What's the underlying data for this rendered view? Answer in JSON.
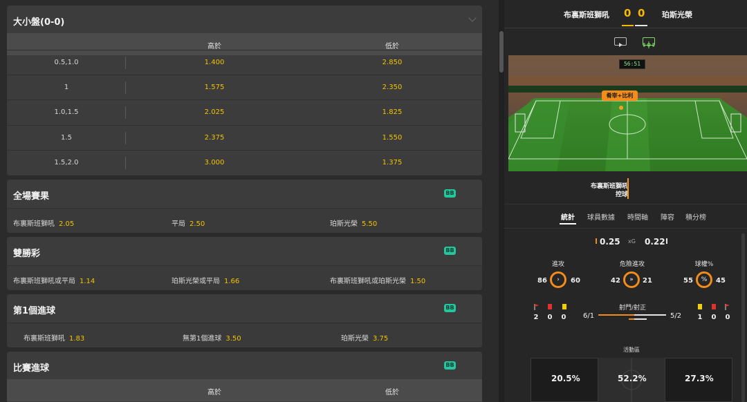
{
  "left": {
    "ou": {
      "title": "大小盤(0-0)",
      "head_over": "高於",
      "head_under": "低於",
      "rows": [
        {
          "line": "0.5,1.0",
          "over": "1.400",
          "under": "2.850"
        },
        {
          "line": "1",
          "over": "1.575",
          "under": "2.350"
        },
        {
          "line": "1.0,1.5",
          "over": "2.025",
          "under": "1.825"
        },
        {
          "line": "1.5",
          "over": "2.375",
          "under": "1.550"
        },
        {
          "line": "1.5,2.0",
          "over": "3.000",
          "under": "1.375"
        }
      ]
    },
    "badge": "BB",
    "full_time": {
      "title": "全場賽果",
      "home": {
        "label": "布裏斯班獅吼",
        "odd": "2.05"
      },
      "draw": {
        "label": "平局",
        "odd": "2.50"
      },
      "away": {
        "label": "珀斯光榮",
        "odd": "5.50"
      }
    },
    "double_chance": {
      "title": "雙勝彩",
      "a": {
        "label": "布裏斯班獅吼或平局",
        "odd": "1.14"
      },
      "b": {
        "label": "珀斯光榮或平局",
        "odd": "1.66"
      },
      "c": {
        "label": "布裏斯班獅吼或珀斯光榮",
        "odd": "1.50"
      }
    },
    "first_goal": {
      "title": "第1個進球",
      "a": {
        "label": "布裏斯班獅吼",
        "odd": "1.83"
      },
      "b": {
        "label": "無第1個進球",
        "odd": "3.50"
      },
      "c": {
        "label": "珀斯光榮",
        "odd": "3.75"
      }
    },
    "match_goals": {
      "title": "比賽進球",
      "head_over": "高於",
      "head_under": "低於"
    }
  },
  "right": {
    "home_team": "布裏斯班獅吼",
    "away_team": "珀斯光榮",
    "home_score": "0",
    "away_score": "0",
    "clock": "56:51",
    "banner": "肴宰+比利",
    "possession_team": "布裏斯班獅吼",
    "possession_label": "控球",
    "tabs": [
      "統計",
      "球員數據",
      "時間軸",
      "陣容",
      "積分榜"
    ],
    "xg": {
      "home": "0.25",
      "label": "xG",
      "away": "0.22"
    },
    "stats": [
      {
        "label": "進攻",
        "home": "86",
        "away": "60",
        "icon": "chevron-right-icon",
        "glyph": "›"
      },
      {
        "label": "危險進攻",
        "home": "42",
        "away": "21",
        "icon": "double-chevron-icon",
        "glyph": "»"
      },
      {
        "label": "球權%",
        "home": "55",
        "away": "45",
        "icon": "percent-icon",
        "glyph": "%"
      }
    ],
    "cards_home": {
      "corners": "2",
      "red": "0",
      "yellow": "0"
    },
    "cards_away": {
      "yellow": "1",
      "red": "0",
      "corners": "0"
    },
    "shots": {
      "label": "射門/射正",
      "home": "6/1",
      "away": "5/2"
    },
    "area": {
      "label": "活動區",
      "left": "20.5%",
      "mid": "52.2%",
      "right": "27.3%"
    },
    "colors": {
      "accent": "#f6b800",
      "orange": "#f28c1a",
      "badge": "#22c79d"
    }
  }
}
